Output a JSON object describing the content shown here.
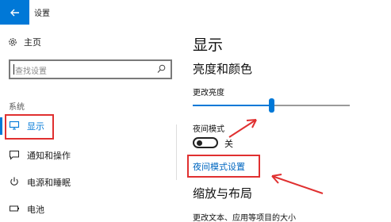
{
  "window": {
    "title": "设置",
    "back_icon": "back-arrow-icon",
    "accent": "#0078d7"
  },
  "sidebar": {
    "home_label": "主页",
    "search_placeholder": "查找设置",
    "section_label": "系统",
    "items": [
      {
        "label": "显示",
        "icon": "monitor-icon",
        "selected": true
      },
      {
        "label": "通知和操作",
        "icon": "notification-icon",
        "selected": false
      },
      {
        "label": "电源和睡眠",
        "icon": "power-icon",
        "selected": false
      },
      {
        "label": "电池",
        "icon": "battery-icon",
        "selected": false
      }
    ]
  },
  "main": {
    "title": "显示",
    "section_brightness": "亮度和颜色",
    "brightness_label": "更改亮度",
    "brightness_value": 0.5,
    "night_mode_label": "夜间模式",
    "night_mode_state": "关",
    "night_mode_on": false,
    "night_mode_link": "夜间模式设置",
    "section_scale": "缩放与布局",
    "scale_text_label": "更改文本、应用等项目的大小"
  },
  "annotation_color": "#e03030"
}
